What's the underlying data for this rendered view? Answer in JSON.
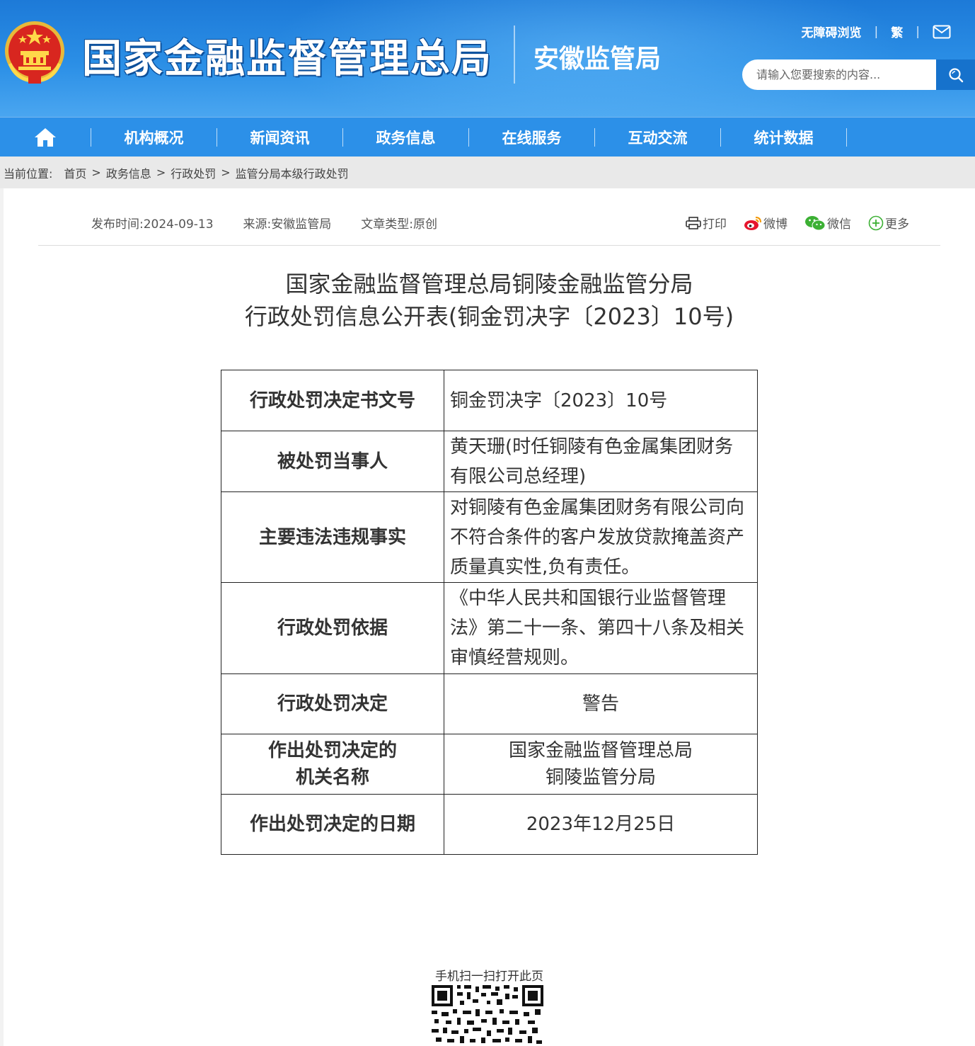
{
  "header": {
    "site_title": "国家金融监督管理总局",
    "sub_title": "安徽监管局",
    "accessibility_link": "无障碍浏览",
    "traditional_link": "繁",
    "mail_icon": "mail-icon",
    "search_placeholder": "请输入您要搜索的内容...",
    "search_icon": "search-icon"
  },
  "nav": {
    "home_icon": "home-icon",
    "items": [
      "机构概况",
      "新闻资讯",
      "政务信息",
      "在线服务",
      "互动交流",
      "统计数据"
    ]
  },
  "breadcrumb": {
    "label": "当前位置:",
    "items": [
      "首页",
      "政务信息",
      "行政处罚",
      "监管分局本级行政处罚"
    ],
    "separator": ">"
  },
  "meta": {
    "publish": "发布时间:2024-09-13",
    "source": "来源:安徽监管局",
    "type": "文章类型:原创"
  },
  "share": {
    "print": "打印",
    "weibo": "微博",
    "wechat": "微信",
    "more": "更多"
  },
  "article": {
    "title_line1": "国家金融监督管理总局铜陵金融监管分局",
    "title_line2": "行政处罚信息公开表(铜金罚决字〔2023〕10号)"
  },
  "table": {
    "rows": [
      {
        "key": "行政处罚决定书文号",
        "value": "铜金罚决字〔2023〕10号"
      },
      {
        "key": "被处罚当事人",
        "value": "黄天珊(时任铜陵有色金属集团财务有限公司总经理)"
      },
      {
        "key": "主要违法违规事实",
        "value": "对铜陵有色金属集团财务有限公司向不符合条件的客户发放贷款掩盖资产质量真实性,负有责任。"
      },
      {
        "key": "行政处罚依据",
        "value": "《中华人民共和国银行业监督管理法》第二十一条、第四十八条及相关审慎经营规则。"
      },
      {
        "key": "行政处罚决定",
        "value": "警告"
      },
      {
        "key_line1": "作出处罚决定的",
        "key_line2": "机关名称",
        "value_line1": "国家金融监督管理总局",
        "value_line2": "铜陵监管分局"
      },
      {
        "key": "作出处罚决定的日期",
        "value": "2023年12月25日"
      }
    ]
  },
  "qr": {
    "label": "手机扫一扫打开此页"
  },
  "colors": {
    "header_blue": "#2b8fe6",
    "nav_blue": "#2c90e8",
    "search_button": "#1672cc"
  }
}
